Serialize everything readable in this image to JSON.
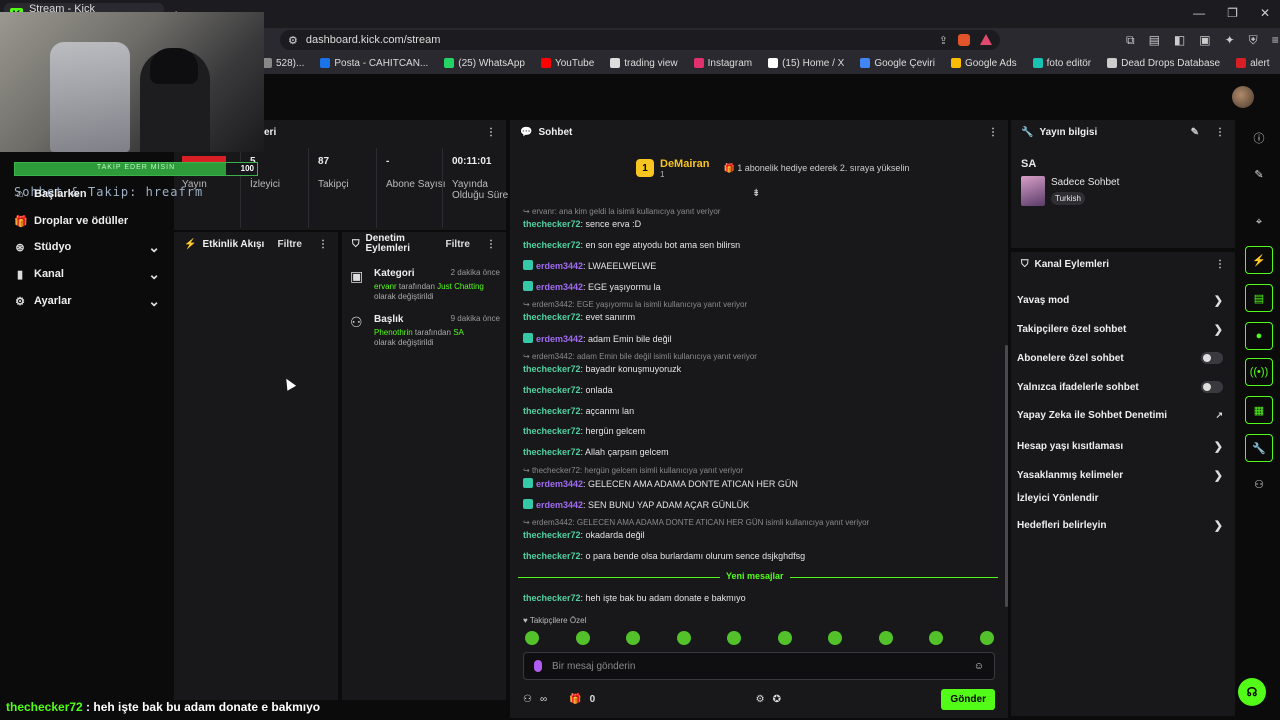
{
  "browser": {
    "tab_title": "Stream - Kick Dashboard",
    "url": "dashboard.kick.com/stream",
    "bookmarks": [
      {
        "label": "528)...",
        "color": "#888888"
      },
      {
        "label": "Posta - CAHITCAN...",
        "color": "#1a73e8"
      },
      {
        "label": "(25) WhatsApp",
        "color": "#25d366"
      },
      {
        "label": "YouTube",
        "color": "#ff0000"
      },
      {
        "label": "trading view",
        "color": "#dddddd"
      },
      {
        "label": "Instagram",
        "color": "#e1306c"
      },
      {
        "label": "(15) Home / X",
        "color": "#ffffff"
      },
      {
        "label": "Google Çeviri",
        "color": "#4285f4"
      },
      {
        "label": "Google Ads",
        "color": "#fbbc04"
      },
      {
        "label": "foto editör",
        "color": "#19c3b4"
      },
      {
        "label": "Dead Drops Database",
        "color": "#cccccc"
      },
      {
        "label": "alert",
        "color": "#d81f26"
      }
    ]
  },
  "overlay": {
    "follow_goal_label": "TAKİP EDER MİSİN",
    "follow_goal_value": "100",
    "follow_goal_fraction": 0.87,
    "scroll_text": "Sohbet & Takip: hreafrm"
  },
  "sidebar": {
    "items": [
      {
        "label": "Başlarken",
        "icon": "home-icon",
        "chevron": false
      },
      {
        "label": "Droplar ve ödüller",
        "icon": "gift-icon",
        "chevron": false
      },
      {
        "label": "Stüdyo",
        "icon": "studio-icon",
        "chevron": true
      },
      {
        "label": "Kanal",
        "icon": "channel-icon",
        "chevron": true
      },
      {
        "label": "Ayarlar",
        "icon": "gear-icon",
        "chevron": true
      }
    ]
  },
  "stats": {
    "title": "eri",
    "items": [
      {
        "value": "5",
        "label": "Yayın"
      },
      {
        "value": "5",
        "label": "İzleyici"
      },
      {
        "value": "87",
        "label": "Takipçi"
      },
      {
        "value": "-",
        "label": "Abone Sayısı"
      },
      {
        "value": "00:11:01",
        "label": "Yayında Olduğu Süre"
      }
    ]
  },
  "activity": {
    "title": "Etkinlik Akışı",
    "filter": "Filtre"
  },
  "mod_actions": {
    "title": "Denetim Eylemleri",
    "filter": "Filtre",
    "items": [
      {
        "title": "Kategori",
        "time": "2 dakika önce",
        "user": "ervanr",
        "mid": " tarafından ",
        "value": "Just Chatting",
        "suffix": "olarak değiştirildi"
      },
      {
        "title": "Başlık",
        "time": "9 dakika önce",
        "user": "Phenothrin",
        "mid": " tarafından ",
        "value": "SA",
        "suffix": "olarak değiştirildi"
      }
    ]
  },
  "chat": {
    "title": "Sohbet",
    "pinned": {
      "name": "DeMairan",
      "sub_count": "1",
      "note": "1 abonelik hediye ederek 2. sıraya yükselin"
    },
    "messages": [
      {
        "type": "reply",
        "text": "ervanr: ana kim geldi la isimli kullanıcıya yanıt veriyor"
      },
      {
        "user": "thechecker72",
        "color": "u1",
        "badge": false,
        "text": ": sence erva :D"
      },
      {
        "user": "thechecker72",
        "color": "u1",
        "badge": false,
        "text": ": en son ege atıyodu bot ama sen bilirsn"
      },
      {
        "user": "erdem3442",
        "color": "u2",
        "badge": true,
        "text": ": LWAEELWELWE"
      },
      {
        "user": "erdem3442",
        "color": "u2",
        "badge": true,
        "text": ": EGE yaşıyormu la"
      },
      {
        "type": "reply",
        "text": "erdem3442: EGE yaşıyormu la isimli kullanıcıya yanıt veriyor"
      },
      {
        "user": "thechecker72",
        "color": "u1",
        "badge": false,
        "text": ": evet sanırım"
      },
      {
        "user": "erdem3442",
        "color": "u2",
        "badge": true,
        "text": ": adam Emin bile değil"
      },
      {
        "type": "reply",
        "text": "erdem3442: adam Emin bile değil isimli kullanıcıya yanıt veriyor"
      },
      {
        "user": "thechecker72",
        "color": "u1",
        "badge": false,
        "text": ": bayadır konuşmuyoruzk"
      },
      {
        "user": "thechecker72",
        "color": "u1",
        "badge": false,
        "text": ": onlada"
      },
      {
        "user": "thechecker72",
        "color": "u1",
        "badge": false,
        "text": ": açcanmı lan"
      },
      {
        "user": "thechecker72",
        "color": "u1",
        "badge": false,
        "text": ": hergün gelcem"
      },
      {
        "user": "thechecker72",
        "color": "u1",
        "badge": false,
        "text": ": Allah çarpsın gelcem"
      },
      {
        "type": "reply",
        "text": "thechecker72: hergün gelcem isimli kullanıcıya yanıt veriyor"
      },
      {
        "user": "erdem3442",
        "color": "u2",
        "badge": true,
        "text": ": GELECEN AMA ADAMA DONTE ATICAN HER GÜN"
      },
      {
        "user": "erdem3442",
        "color": "u2",
        "badge": true,
        "text": ": SEN BUNU YAP ADAM AÇAR GÜNLÜK"
      },
      {
        "type": "reply",
        "text": "erdem3442: GELECEN AMA ADAMA DONTE ATICAN HER GÜN isimli kullanıcıya yanıt veriyor"
      },
      {
        "user": "thechecker72",
        "color": "u1",
        "badge": false,
        "text": ": okadarda değil"
      },
      {
        "user": "thechecker72",
        "color": "u1",
        "badge": false,
        "text": ": o para bende olsa burlardamı olurum sence dsjkghdfsg"
      },
      {
        "user": "thechecker72",
        "color": "u1",
        "badge": false,
        "text": ": heh işte bak bu adam donate e bakmıyo"
      }
    ],
    "new_messages": "Yeni mesajlar",
    "followers_only": "♥ Takipçilere Özel",
    "input_placeholder": "Bir mesaj gönderin",
    "infinity": "∞",
    "count": "0",
    "send": "Gönder"
  },
  "stream_info": {
    "title": "Yayın bilgisi",
    "stream_title": "SA",
    "category": "Sadece Sohbet",
    "language": "Turkish"
  },
  "channel_actions": {
    "title": "Kanal Eylemleri",
    "items": [
      {
        "label": "Yavaş mod",
        "control": "chevron"
      },
      {
        "label": "Takipçilere özel sohbet",
        "control": "chevron"
      },
      {
        "label": "Abonelere özel sohbet",
        "control": "toggle"
      },
      {
        "label": "Yalnızca ifadelerle sohbet",
        "control": "toggle"
      },
      {
        "label": "Yapay Zeka ile Sohbet Denetimi",
        "control": "external"
      },
      {
        "label": "Hesap yaşı kısıtlaması",
        "control": "chevron"
      },
      {
        "label": "Yasaklanmış kelimeler",
        "control": "chevron"
      },
      {
        "label": "İzleyici Yönlendir",
        "control": "none"
      },
      {
        "label": "Hedefleri belirleyin",
        "control": "chevron"
      }
    ]
  },
  "subtitle": {
    "user": "thechecker72",
    "text": " : heh işte bak bu adam donate e bakmıyo"
  }
}
